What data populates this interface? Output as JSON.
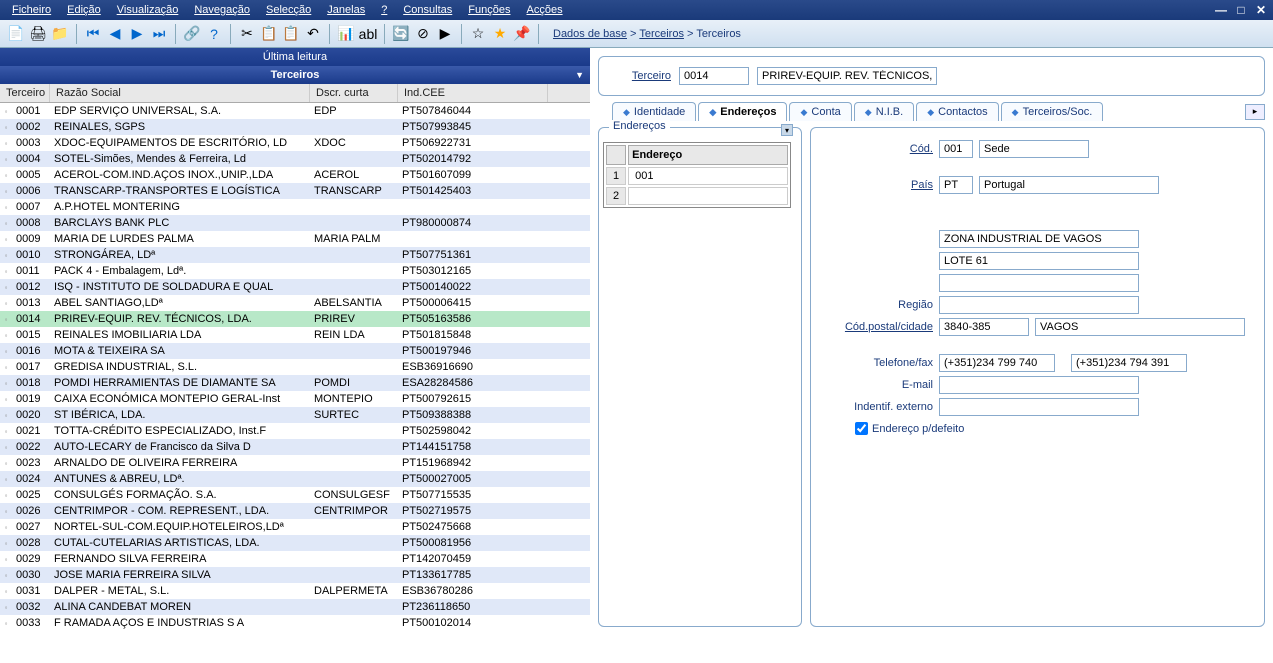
{
  "menu": [
    "Ficheiro",
    "Edição",
    "Visualização",
    "Navegação",
    "Selecção",
    "Janelas",
    "?",
    "Consultas",
    "Funções",
    "Acções"
  ],
  "breadcrumb": {
    "a": "Dados de base",
    "b": "Terceiros",
    "c": "Terceiros"
  },
  "ultima": "Última leitura",
  "terceiros_title": "Terceiros",
  "columns": {
    "code": "Terceiro",
    "razao": "Razão Social",
    "dscr": "Dscr. curta",
    "cee": "Ind.CEE"
  },
  "rows": [
    {
      "c": "0001",
      "r": "EDP SERVIÇO UNIVERSAL, S.A.",
      "d": "EDP",
      "ce": "PT507846044"
    },
    {
      "c": "0002",
      "r": "REINALES, SGPS",
      "d": "",
      "ce": "PT507993845"
    },
    {
      "c": "0003",
      "r": "XDOC-EQUIPAMENTOS DE ESCRITÓRIO, LD",
      "d": "XDOC",
      "ce": "PT506922731"
    },
    {
      "c": "0004",
      "r": "SOTEL-Simões, Mendes & Ferreira, Ld",
      "d": "",
      "ce": "PT502014792"
    },
    {
      "c": "0005",
      "r": "ACEROL-COM.IND.AÇOS INOX.,UNIP.,LDA",
      "d": "ACEROL",
      "ce": "PT501607099"
    },
    {
      "c": "0006",
      "r": "TRANSCARP-TRANSPORTES E LOGÍSTICA",
      "d": "TRANSCARP",
      "ce": "PT501425403"
    },
    {
      "c": "0007",
      "r": "A.P.HOTEL MONTERING",
      "d": "",
      "ce": ""
    },
    {
      "c": "0008",
      "r": "BARCLAYS BANK PLC",
      "d": "",
      "ce": "PT980000874"
    },
    {
      "c": "0009",
      "r": "MARIA DE LURDES PALMA",
      "d": "MARIA PALM",
      "ce": ""
    },
    {
      "c": "0010",
      "r": "STRONGÁREA, LDª",
      "d": "",
      "ce": "PT507751361"
    },
    {
      "c": "0011",
      "r": "PACK  4 - Embalagem, Ldª.",
      "d": "",
      "ce": "PT503012165"
    },
    {
      "c": "0012",
      "r": "ISQ - INSTITUTO DE SOLDADURA E QUAL",
      "d": "",
      "ce": "PT500140022"
    },
    {
      "c": "0013",
      "r": "ABEL SANTIAGO,LDª",
      "d": "ABELSANTIA",
      "ce": "PT500006415"
    },
    {
      "c": "0014",
      "r": "PRIREV-EQUIP. REV. TÉCNICOS, LDA.",
      "d": "PRIREV",
      "ce": "PT505163586",
      "sel": true
    },
    {
      "c": "0015",
      "r": "REINALES IMOBILIARIA LDA",
      "d": "REIN LDA",
      "ce": "PT501815848"
    },
    {
      "c": "0016",
      "r": "MOTA & TEIXEIRA SA",
      "d": "",
      "ce": "PT500197946"
    },
    {
      "c": "0017",
      "r": "GREDISA INDUSTRIAL, S.L.",
      "d": "",
      "ce": "ESB36916690"
    },
    {
      "c": "0018",
      "r": "POMDI HERRAMIENTAS DE DIAMANTE SA",
      "d": "POMDI",
      "ce": "ESA28284586"
    },
    {
      "c": "0019",
      "r": "CAIXA ECONÓMICA MONTEPIO GERAL-Inst",
      "d": "MONTEPIO",
      "ce": "PT500792615"
    },
    {
      "c": "0020",
      "r": "ST IBÉRICA, LDA.",
      "d": "SURTEC",
      "ce": "PT509388388"
    },
    {
      "c": "0021",
      "r": "TOTTA-CRÉDITO ESPECIALIZADO, Inst.F",
      "d": "",
      "ce": "PT502598042"
    },
    {
      "c": "0022",
      "r": "AUTO-LECARY de Francisco da Silva D",
      "d": "",
      "ce": "PT144151758"
    },
    {
      "c": "0023",
      "r": "ARNALDO DE OLIVEIRA FERREIRA",
      "d": "",
      "ce": "PT151968942"
    },
    {
      "c": "0024",
      "r": "ANTUNES & ABREU, LDª.",
      "d": "",
      "ce": "PT500027005"
    },
    {
      "c": "0025",
      "r": "CONSULGÉS FORMAÇÃO. S.A.",
      "d": "CONSULGESF",
      "ce": "PT507715535"
    },
    {
      "c": "0026",
      "r": "CENTRIMPOR - COM. REPRESENT., LDA.",
      "d": "CENTRIMPOR",
      "ce": "PT502719575"
    },
    {
      "c": "0027",
      "r": "NORTEL-SUL-COM.EQUIP.HOTELEIROS,LDª",
      "d": "",
      "ce": "PT502475668"
    },
    {
      "c": "0028",
      "r": "CUTAL-CUTELARIAS ARTISTICAS, LDA.",
      "d": "",
      "ce": "PT500081956"
    },
    {
      "c": "0029",
      "r": "FERNANDO SILVA FERREIRA",
      "d": "",
      "ce": "PT142070459"
    },
    {
      "c": "0030",
      "r": "JOSE MARIA FERREIRA SILVA",
      "d": "",
      "ce": "PT133617785"
    },
    {
      "c": "0031",
      "r": "DALPER - METAL, S.L.",
      "d": "DALPERMETA",
      "ce": "ESB36780286"
    },
    {
      "c": "0032",
      "r": "ALINA CANDEBAT MOREN",
      "d": "",
      "ce": "PT236118650"
    },
    {
      "c": "0033",
      "r": "F RAMADA AÇOS E INDUSTRIAS S A",
      "d": "",
      "ce": "PT500102014"
    }
  ],
  "terceiro_label": "Terceiro",
  "terceiro_code": "0014",
  "terceiro_name": "PRIREV-EQUIP. REV. TÉCNICOS,",
  "tabs": [
    "Identidade",
    "Endereços",
    "Conta",
    "N.I.B.",
    "Contactos",
    "Terceiros/Soc."
  ],
  "active_tab": 1,
  "addr_legend": "Endereços",
  "addr_col": "Endereço",
  "addr_rows": [
    {
      "n": "1",
      "v": "001"
    },
    {
      "n": "2",
      "v": ""
    }
  ],
  "detail": {
    "cod_label": "Cód.",
    "cod": "001",
    "cod_desc": "Sede",
    "pais_label": "País",
    "pais": "PT",
    "pais_desc": "Portugal",
    "addr1": "ZONA INDUSTRIAL DE VAGOS",
    "addr2": "LOTE 61",
    "addr3": "",
    "regiao_label": "Região",
    "regiao": "",
    "cp_label": "Cód.postal/cidade",
    "cp": "3840-385",
    "cidade": "VAGOS",
    "tel_label": "Telefone/fax",
    "tel": "(+351)234 799 740",
    "fax": "(+351)234 794 391",
    "email_label": "E-mail",
    "email": "",
    "ident_label": "Indentif. externo",
    "ident": "",
    "defeito_label": "Endereço p/defeito"
  }
}
